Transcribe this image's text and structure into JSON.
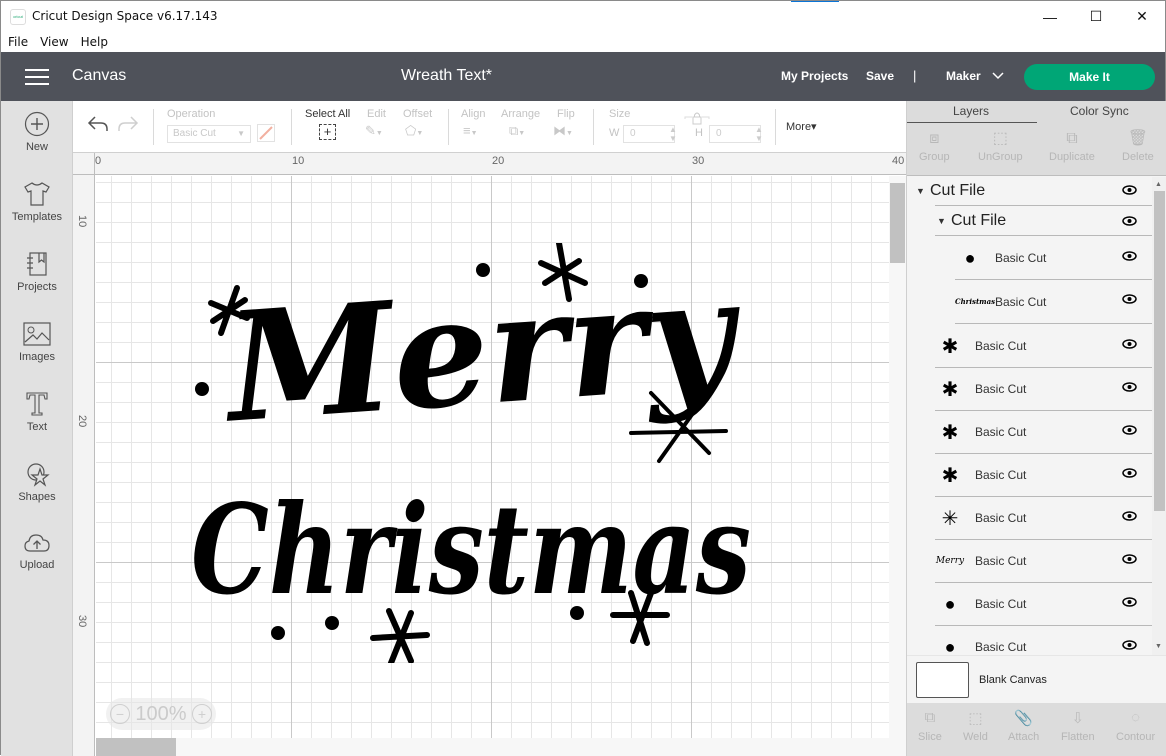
{
  "window": {
    "app_title": "Cricut Design Space  v6.17.143",
    "logo_text": "cricut",
    "controls": {
      "minimize": "—",
      "maximize": "☐",
      "close": "✕"
    }
  },
  "menu": [
    "File",
    "View",
    "Help"
  ],
  "header": {
    "section": "Canvas",
    "project_title": "Wreath Text*",
    "my_projects": "My Projects",
    "save": "Save",
    "separator": "|",
    "machine": "Maker",
    "make_it": "Make It",
    "accent_color": "#00a676"
  },
  "leftnav": [
    {
      "label": "New",
      "icon": "plus-circle-icon"
    },
    {
      "label": "Templates",
      "icon": "tshirt-icon"
    },
    {
      "label": "Projects",
      "icon": "notebook-icon"
    },
    {
      "label": "Images",
      "icon": "image-icon"
    },
    {
      "label": "Text",
      "icon": "text-icon"
    },
    {
      "label": "Shapes",
      "icon": "shapes-icon"
    },
    {
      "label": "Upload",
      "icon": "upload-cloud-icon"
    }
  ],
  "toolbar": {
    "operation_label": "Operation",
    "operation_value": "Basic Cut",
    "select_all": "Select All",
    "edit": "Edit",
    "offset": "Offset",
    "align": "Align",
    "arrange": "Arrange",
    "flip": "Flip",
    "size": "Size",
    "w_label": "W",
    "w_value": "0",
    "h_label": "H",
    "h_value": "0",
    "more": "More▾"
  },
  "canvas": {
    "ruler_top": [
      "0",
      "10",
      "20",
      "30",
      "40"
    ],
    "ruler_left": [
      "10",
      "20",
      "30"
    ],
    "zoom": "100%",
    "zoom_minus": "−",
    "zoom_plus": "+",
    "artwork_text_line1": "Merry",
    "artwork_text_line2": "Christmas"
  },
  "panel": {
    "tabs": [
      "Layers",
      "Color Sync"
    ],
    "actions": [
      "Group",
      "UnGroup",
      "Duplicate",
      "Delete"
    ],
    "layers": [
      {
        "label": "Cut File",
        "level": 0,
        "type": "group"
      },
      {
        "label": "Cut File",
        "level": 1,
        "type": "group"
      },
      {
        "label": "Basic Cut",
        "level": 2,
        "thumb": "●"
      },
      {
        "label": "Basic Cut",
        "level": 2,
        "thumb": "Christmas"
      },
      {
        "label": "Basic Cut",
        "level": 1,
        "thumb": "✱"
      },
      {
        "label": "Basic Cut",
        "level": 1,
        "thumb": "✱"
      },
      {
        "label": "Basic Cut",
        "level": 1,
        "thumb": "✱"
      },
      {
        "label": "Basic Cut",
        "level": 1,
        "thumb": "✱"
      },
      {
        "label": "Basic Cut",
        "level": 1,
        "thumb": "✳"
      },
      {
        "label": "Basic Cut",
        "level": 1,
        "thumb": "Merry"
      },
      {
        "label": "Basic Cut",
        "level": 1,
        "thumb": "●"
      },
      {
        "label": "Basic Cut",
        "level": 1,
        "thumb": "●"
      }
    ],
    "blank_canvas": "Blank Canvas",
    "bottom_actions": [
      "Slice",
      "Weld",
      "Attach",
      "Flatten",
      "Contour"
    ]
  }
}
